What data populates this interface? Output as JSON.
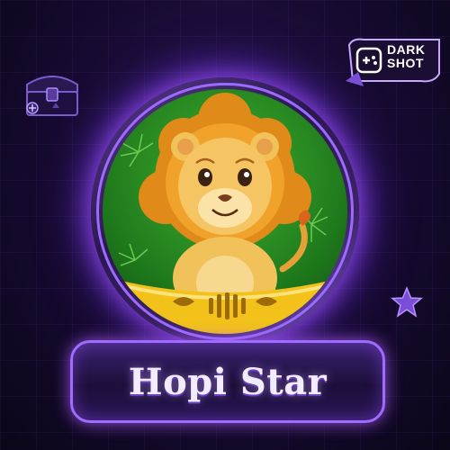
{
  "game": {
    "title": "Hopi Star"
  },
  "brand": {
    "line1": "DARK",
    "line2": "SHOT"
  },
  "icons": {
    "portrait": "lion-icon",
    "brand": "gamepad-icon",
    "decor_left": "treasure-chest-icon",
    "decor_right": "star-icon"
  },
  "colors": {
    "background": "#160a30",
    "accent": "#a06bff",
    "glow": "#9b4dff",
    "portrait_green": "#2f8f23",
    "banner_gold": "#f2c21a"
  }
}
